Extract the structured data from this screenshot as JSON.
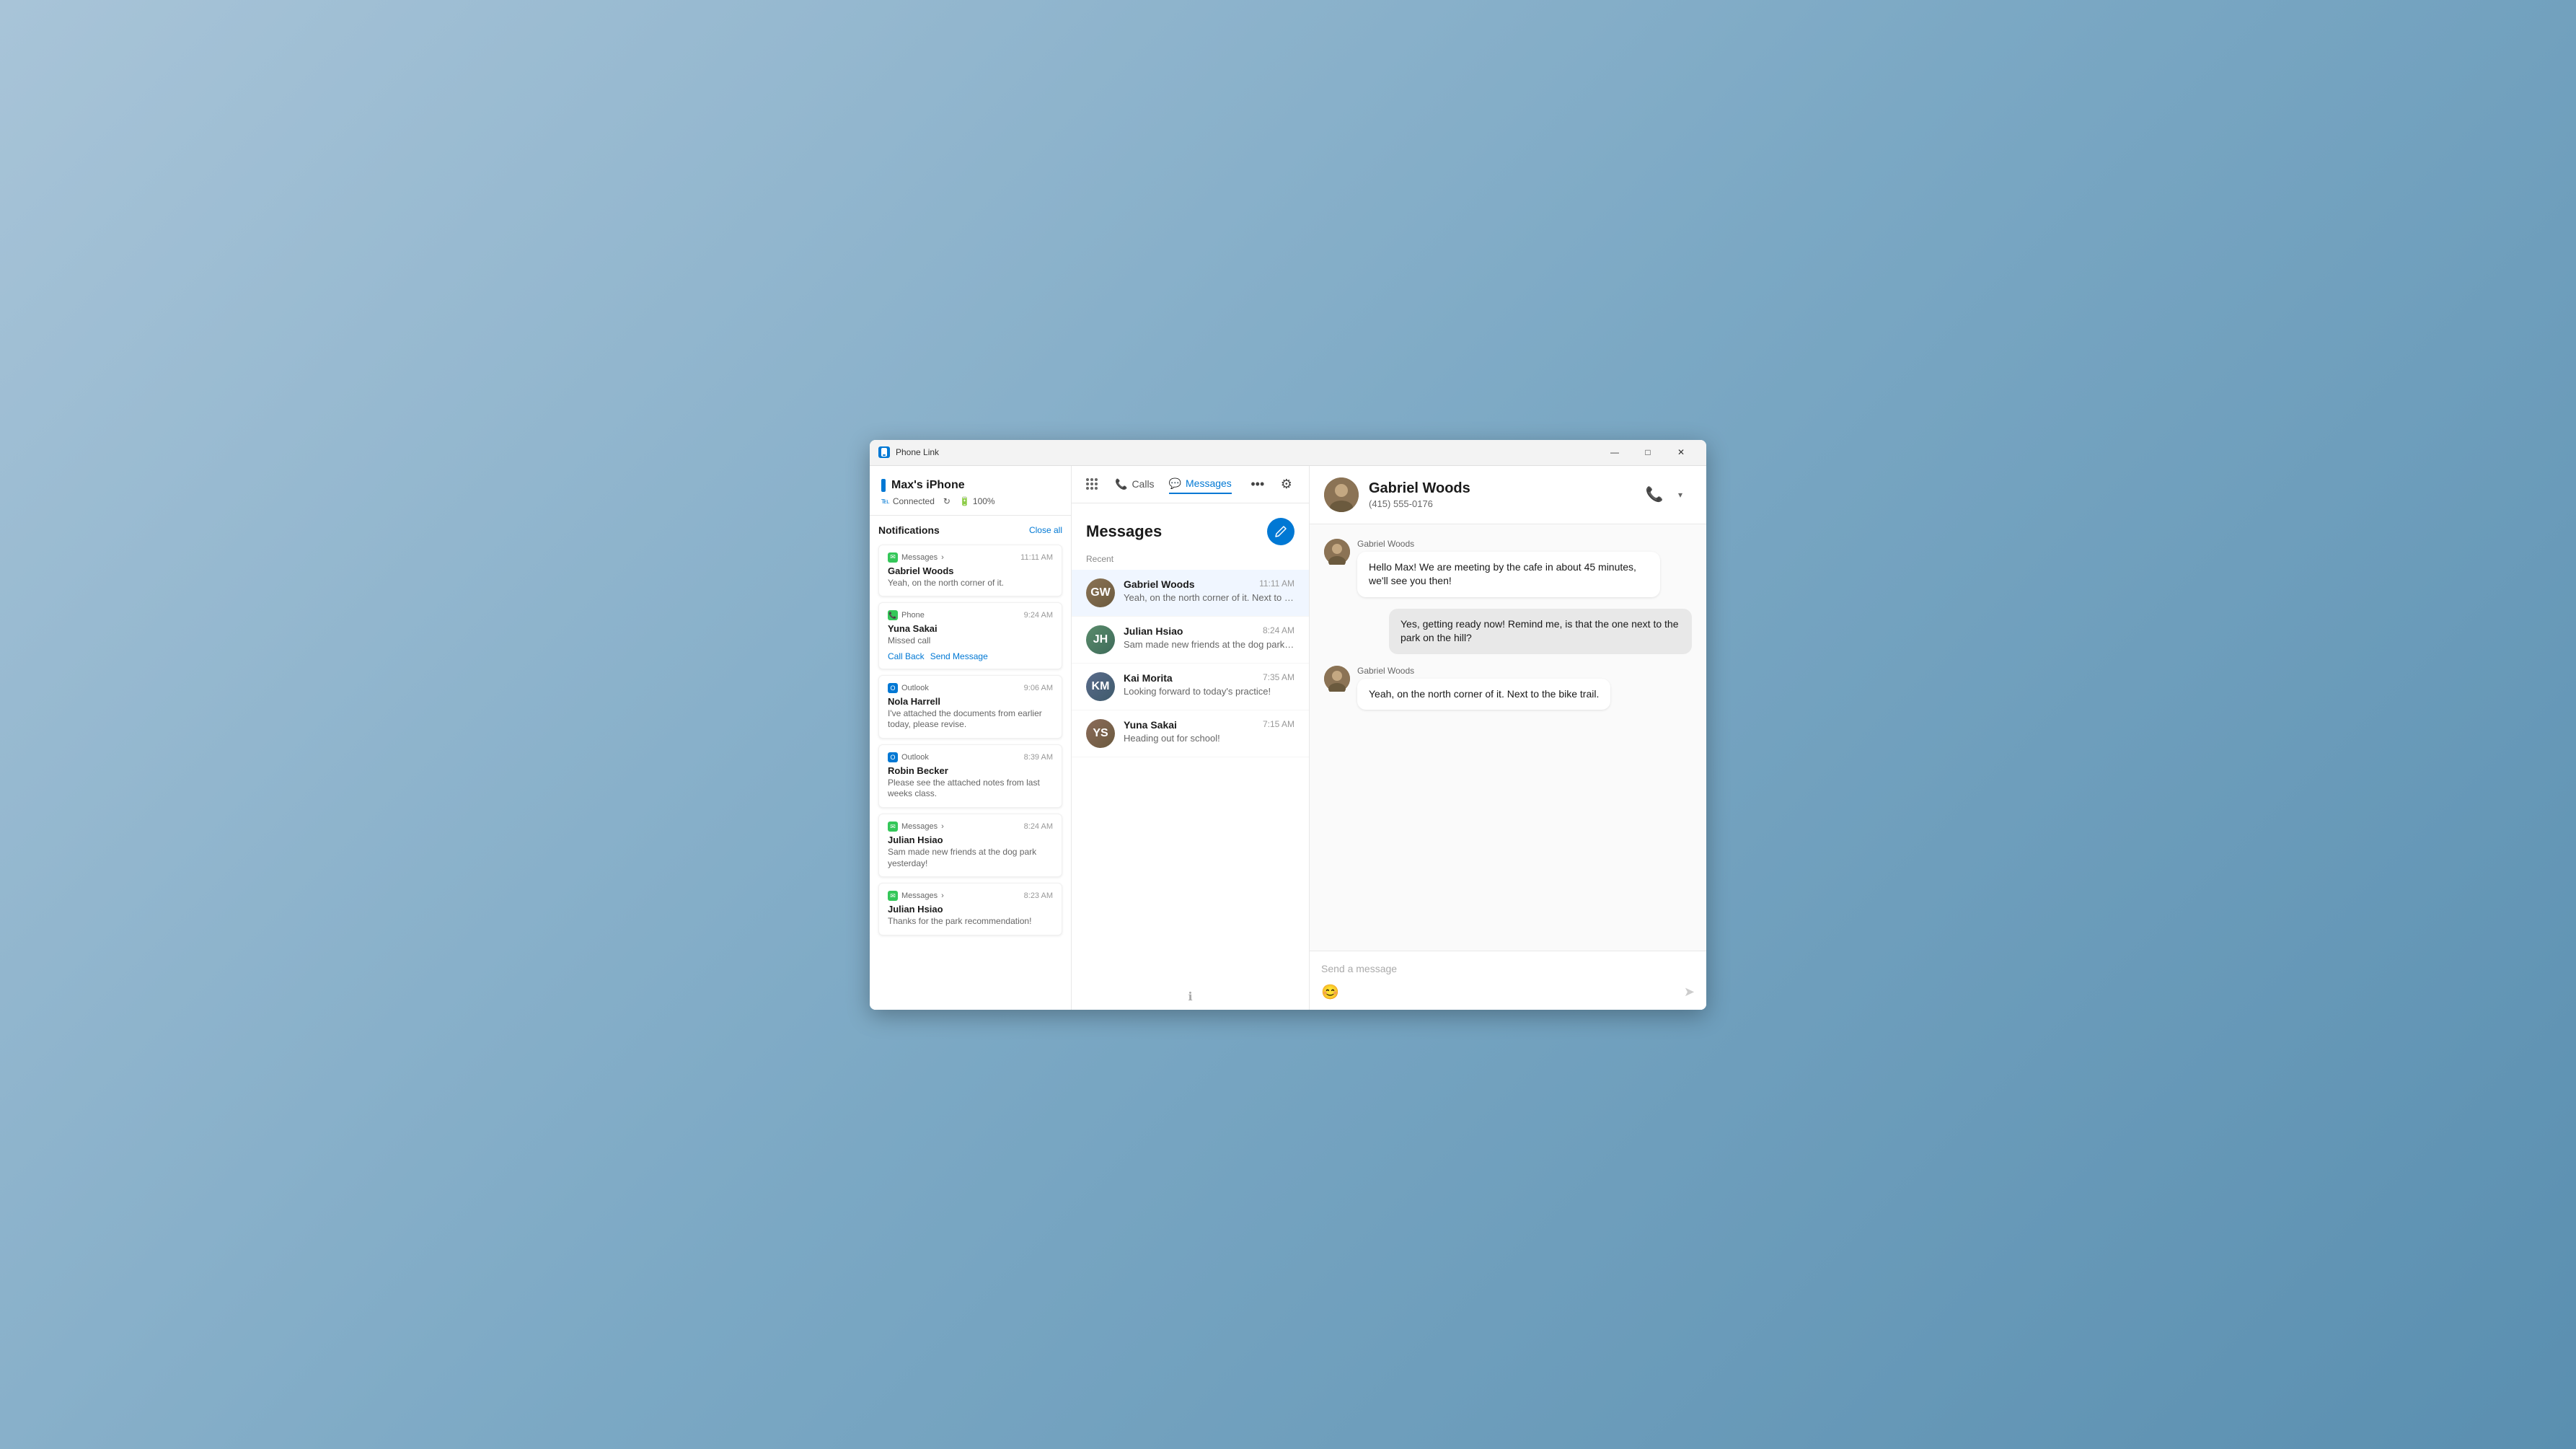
{
  "titlebar": {
    "title": "Phone Link",
    "app_icon": "📱"
  },
  "window_controls": {
    "minimize": "—",
    "maximize": "□",
    "close": "✕"
  },
  "phone": {
    "name": "Max's iPhone",
    "status": "Connected",
    "battery": "100%",
    "refresh_icon": "↻"
  },
  "sidebar": {
    "notifications_title": "Notifications",
    "close_all": "Close all",
    "cards": [
      {
        "app": "Messages",
        "app_type": "messages",
        "time": "11:11 AM",
        "sender": "Gabriel Woods",
        "preview": "Yeah, on the north corner of it.",
        "has_actions": false,
        "arrow": "›"
      },
      {
        "app": "Phone",
        "app_type": "phone",
        "time": "9:24 AM",
        "sender": "Yuna Sakai",
        "preview": "Missed call",
        "has_actions": true,
        "action1": "Call Back",
        "action2": "Send Message"
      },
      {
        "app": "Outlook",
        "app_type": "outlook",
        "time": "9:06 AM",
        "sender": "Nola Harrell",
        "preview": "I've attached the documents from earlier today, please revise.",
        "has_actions": false
      },
      {
        "app": "Outlook",
        "app_type": "outlook",
        "time": "8:39 AM",
        "sender": "Robin Becker",
        "preview": "Please see the attached notes from last weeks class.",
        "has_actions": false
      },
      {
        "app": "Messages",
        "app_type": "messages",
        "time": "8:24 AM",
        "sender": "Julian Hsiao",
        "preview": "Sam made new friends at the dog park yesterday!",
        "has_actions": false,
        "arrow": "›"
      },
      {
        "app": "Messages",
        "app_type": "messages",
        "time": "8:23 AM",
        "sender": "Julian Hsiao",
        "preview": "Thanks for the park recommendation!",
        "has_actions": false,
        "arrow": "›"
      }
    ]
  },
  "nav": {
    "calls_label": "Calls",
    "messages_label": "Messages",
    "more_icon": "•••",
    "settings_icon": "⚙"
  },
  "messages_panel": {
    "title": "Messages",
    "recent_label": "Recent",
    "info_tooltip": "ℹ",
    "conversations": [
      {
        "name": "Gabriel Woods",
        "time": "11:11 AM",
        "preview": "Yeah, on the north corner of it. Next to the bike trail.",
        "avatar_initials": "GW",
        "avatar_class": "avatar-gw",
        "active": true
      },
      {
        "name": "Julian Hsiao",
        "time": "8:24 AM",
        "preview": "Sam made new friends at the dog park yesterday!",
        "avatar_initials": "JH",
        "avatar_class": "avatar-jh",
        "active": false
      },
      {
        "name": "Kai Morita",
        "time": "7:35 AM",
        "preview": "Looking forward to today's practice!",
        "avatar_initials": "KM",
        "avatar_class": "avatar-km",
        "active": false
      },
      {
        "name": "Yuna Sakai",
        "time": "7:15 AM",
        "preview": "Heading out for school!",
        "avatar_initials": "YS",
        "avatar_class": "avatar-ys",
        "active": false
      }
    ]
  },
  "chat": {
    "contact_name": "Gabriel Woods",
    "contact_phone": "(415) 555-0176",
    "messages": [
      {
        "type": "received",
        "sender": "Gabriel Woods",
        "text": "Hello Max! We are meeting by the cafe in about 45 minutes, we'll see you then!"
      },
      {
        "type": "sent",
        "text": "Yes, getting ready now! Remind me, is that the one next to the park on the hill?"
      },
      {
        "type": "received",
        "sender": "Gabriel Woods",
        "text": "Yeah, on the north corner of it. Next to the bike trail."
      }
    ],
    "input_placeholder": "Send a message",
    "emoji_label": "😊",
    "send_label": "➤"
  }
}
